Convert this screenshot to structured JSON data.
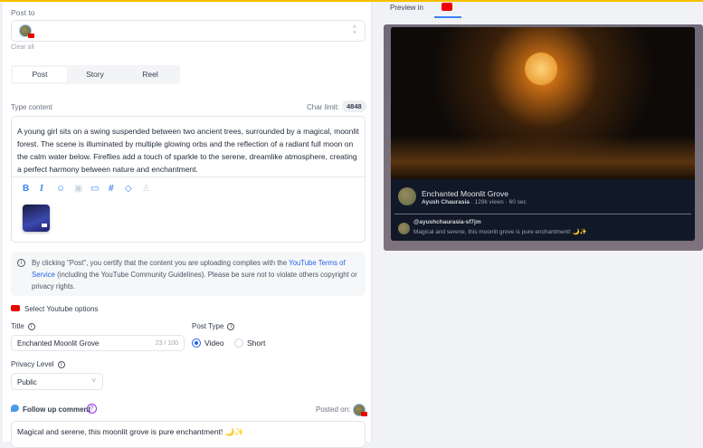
{
  "post_to": {
    "label": "Post to",
    "clear_all": "Clear all"
  },
  "tabs": [
    {
      "label": "Post"
    },
    {
      "label": "Story"
    },
    {
      "label": "Reel"
    }
  ],
  "content": {
    "label": "Type content",
    "char_limit_label": "Char limit:",
    "char_limit": "4848",
    "text": "A young girl sits on a swing suspended between two ancient trees, surrounded by a magical, moonlit forest. The scene is illuminated by multiple glowing orbs and the reflection of a radiant full moon on the calm water below. Fireflies add a touch of sparkle to the serene, dreamlike atmosphere, creating a perfect harmony between nature and enchantment."
  },
  "notice": {
    "text1": "By clicking \"Post\", you certify that the content you are uploading complies with the ",
    "link": "YouTube Terms of Service",
    "text2": " (including the YouTube Community Guidelines). Please be sure not to violate others copyright or privacy rights."
  },
  "youtube": {
    "section_label": "Select Youtube options",
    "title_label": "Title",
    "title_value": "Enchanted Moonlit Grove",
    "title_count": "23 / 100",
    "post_type_label": "Post Type",
    "video": "Video",
    "short": "Short",
    "privacy_label": "Privacy Level",
    "privacy_value": "Public"
  },
  "followup": {
    "label": "Follow up comment",
    "posted_on": "Posted on:",
    "text": "Magical and serene, this moonlit grove is pure enchantment! 🌙✨"
  },
  "preview": {
    "tab_label": "Preview in",
    "title": "Enchanted Moonlit Grove",
    "channel": "Ayush Chaurasia",
    "views": "129k views",
    "duration": "60 sec",
    "comment_user": "@ayushchaurasia-sf7jm",
    "comment_text": "Magical and serene, this moonlit grove is pure enchantment! 🌙✨"
  }
}
